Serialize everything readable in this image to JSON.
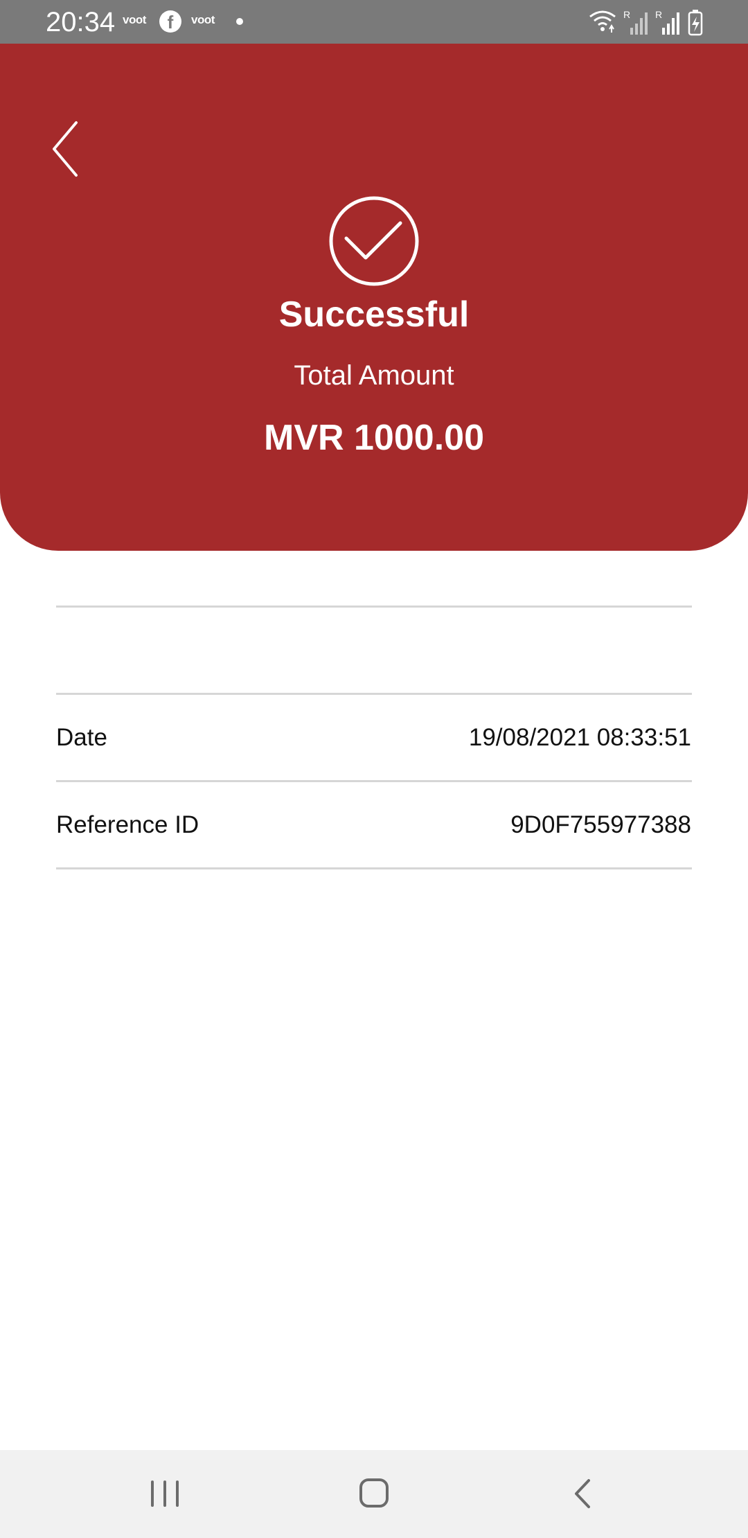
{
  "status_bar": {
    "time": "20:34",
    "app_icons": [
      "voot",
      "facebook",
      "voot"
    ],
    "signal_label_1": "R",
    "signal_label_2": "R"
  },
  "header": {
    "background_color": "#a52a2b",
    "back_icon": "chevron-left-icon",
    "status_icon": "check-circle-icon",
    "title": "Successful",
    "amount_label": "Total Amount",
    "amount_value": "MVR 1000.00"
  },
  "details": [
    {
      "label": "Date",
      "value": "19/08/2021 08:33:51"
    },
    {
      "label": "Reference ID",
      "value": "9D0F755977388"
    }
  ],
  "nav_bar": {
    "buttons": [
      "recent-apps-icon",
      "home-icon",
      "back-icon"
    ]
  }
}
